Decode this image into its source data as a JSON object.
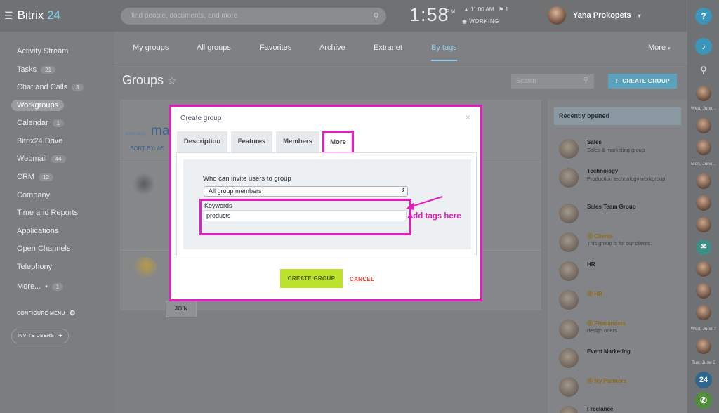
{
  "topbar": {
    "logo_text": "Bitrix",
    "logo_num": "24",
    "search_placeholder": "find people, documents, and more",
    "time": "1:58",
    "ampm": "PM",
    "alarm": "11:00 AM",
    "flag": "1",
    "status": "WORKING",
    "user_name": "Yana Prokopets"
  },
  "sidebar": {
    "items": [
      {
        "label": "Activity Stream",
        "count": ""
      },
      {
        "label": "Tasks",
        "count": "21"
      },
      {
        "label": "Chat and Calls",
        "count": "3"
      },
      {
        "label": "Workgroups",
        "count": ""
      },
      {
        "label": "Calendar",
        "count": "1"
      },
      {
        "label": "Bitrix24.Drive",
        "count": ""
      },
      {
        "label": "Webmail",
        "count": "44"
      },
      {
        "label": "CRM",
        "count": "12"
      },
      {
        "label": "Company",
        "count": ""
      },
      {
        "label": "Time and Reports",
        "count": ""
      },
      {
        "label": "Applications",
        "count": ""
      },
      {
        "label": "Open Channels",
        "count": ""
      },
      {
        "label": "Telephony",
        "count": ""
      },
      {
        "label": "More...",
        "count": "1"
      }
    ],
    "configure_menu": "CONFIGURE MENU",
    "invite_users": "INVITE USERS"
  },
  "tabs": {
    "items": [
      "My groups",
      "All groups",
      "Favorites",
      "Archive",
      "Extranet",
      "By tags"
    ],
    "more": "More",
    "active": "By tags"
  },
  "main": {
    "title": "Groups",
    "search_placeholder": "Search",
    "create_button": "CREATE GROUP",
    "tag_word": "advertising",
    "heading_fragment": "ma",
    "sort_by": "SORT BY:",
    "sort_value": "AE",
    "join_button": "JOIN"
  },
  "recent": {
    "header": "Recently opened",
    "items": [
      {
        "name": "Sales",
        "sub": "Sales & marketing group",
        "extranet": false
      },
      {
        "name": "Technology",
        "sub": "Production technology workgroup",
        "extranet": false
      },
      {
        "name": "Sales Team Group",
        "sub": "",
        "extranet": false
      },
      {
        "name": "Clients",
        "sub": "This group is for our clients.",
        "extranet": true
      },
      {
        "name": "HR",
        "sub": "",
        "extranet": false
      },
      {
        "name": "HR",
        "sub": "",
        "extranet": true
      },
      {
        "name": "Freelancers",
        "sub": "design oders",
        "extranet": true
      },
      {
        "name": "Event Marketing",
        "sub": "",
        "extranet": false
      },
      {
        "name": "My Partners",
        "sub": "",
        "extranet": true
      },
      {
        "name": "Freelance",
        "sub": "",
        "extranet": false
      }
    ]
  },
  "rightbar": {
    "help": "?",
    "dates": [
      "Wed, June...",
      "Mon, June...",
      "Wed, June 7",
      "Tue, June 6"
    ],
    "b24": "24"
  },
  "modal": {
    "title": "Create group",
    "close": "×",
    "tabs": [
      "Description",
      "Features",
      "Members",
      "More"
    ],
    "active_tab": "More",
    "invite_label": "Who can invite users to group",
    "invite_value": "All group members",
    "keywords_label": "Keywords",
    "keywords_value": "products",
    "create_button": "CREATE GROUP",
    "cancel_button": "CANCEL"
  },
  "annotation": {
    "text": "Add tags here",
    "color": "#e11fc1"
  },
  "colors": {
    "accent": "#e11fc1",
    "create_green": "#bde22b",
    "link_blue": "#8fcdec"
  }
}
